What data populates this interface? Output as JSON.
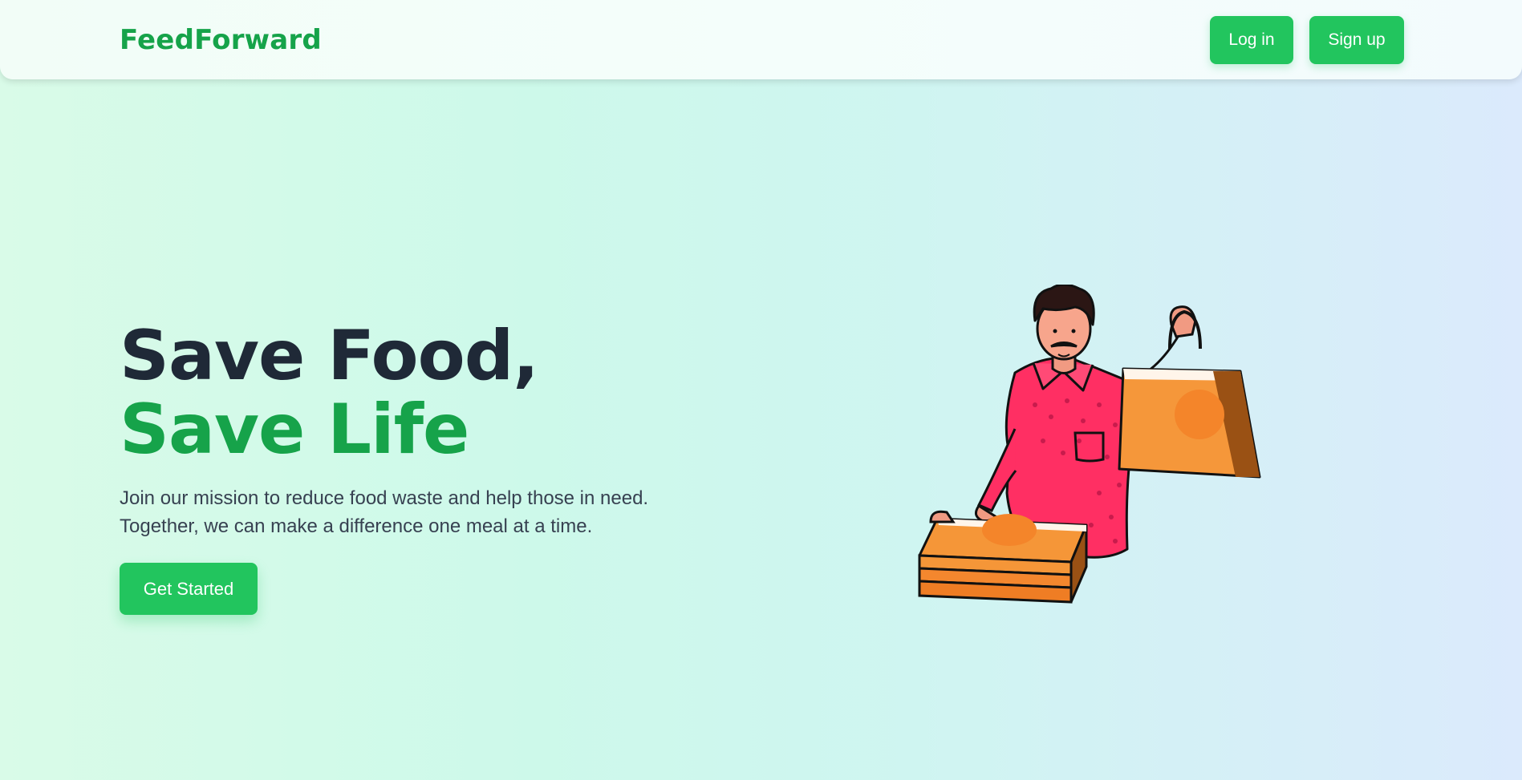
{
  "header": {
    "brand": "FeedForward",
    "login_label": "Log in",
    "signup_label": "Sign up"
  },
  "hero": {
    "title_line1": "Save Food,",
    "title_line2": "Save Life",
    "description_line1": "Join our mission to reduce food waste and help those in need.",
    "description_line2": "Together, we can make a difference one meal at a time.",
    "cta_label": "Get Started",
    "illustration": "delivery-person-illustration"
  },
  "colors": {
    "brand_green": "#16a34a",
    "button_green": "#22c55e",
    "heading_dark": "#1f2937"
  }
}
